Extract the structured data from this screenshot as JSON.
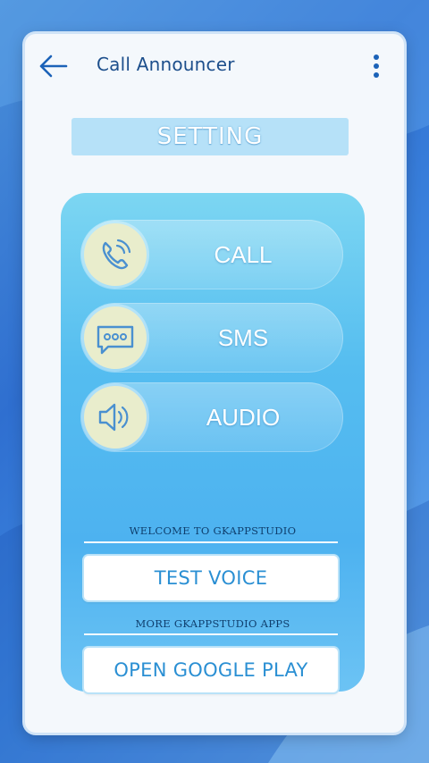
{
  "app": {
    "title": "Call Announcer"
  },
  "banner": {
    "label": "SETTING"
  },
  "menu": [
    {
      "label": "CALL",
      "icon": "phone-ringing-icon"
    },
    {
      "label": "SMS",
      "icon": "chat-bubble-icon"
    },
    {
      "label": "AUDIO",
      "icon": "speaker-icon"
    }
  ],
  "welcome": {
    "caption": "WELCOME TO GKAPPSTUDIO",
    "button_label": "TEST VOICE"
  },
  "more": {
    "caption": "MORE GKAPPSTUDIO APPS",
    "button_label": "OPEN GOOGLE PLAY"
  },
  "colors": {
    "accent": "#2a8fd3",
    "title": "#1d4f8c",
    "panel": "#55bdf0",
    "background": "#2f6fd0"
  }
}
